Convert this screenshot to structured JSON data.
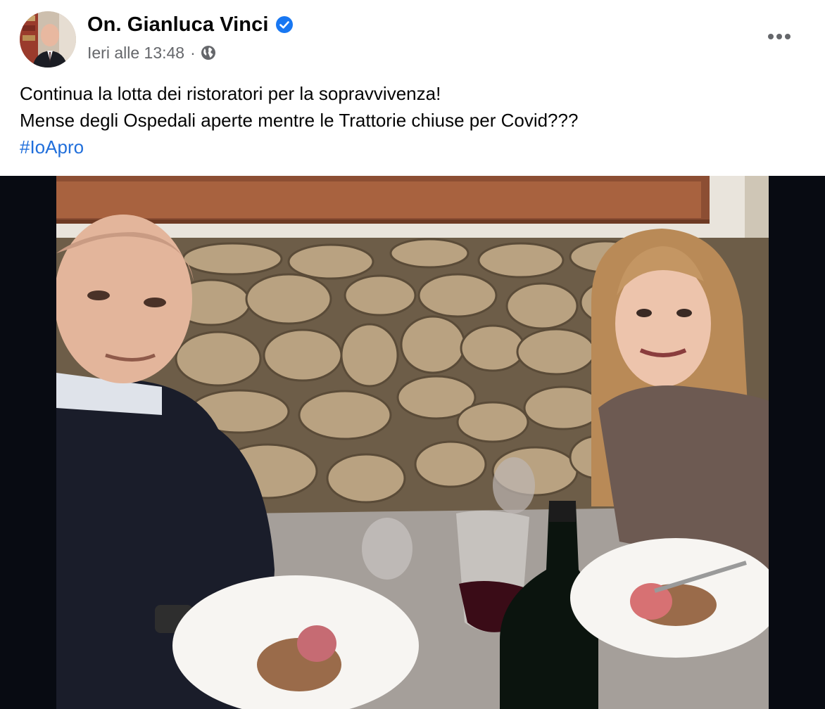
{
  "post": {
    "author": "On. Gianluca Vinci",
    "timestamp": "Ieri alle 13:48",
    "separator": "·",
    "audience_icon": "globe-icon",
    "verified_icon": "verified-badge-icon",
    "more_icon": "more-options-icon",
    "text_lines": [
      "Continua la lotta dei ristoratori per la sopravvivenza!",
      "Mense degli Ospedali aperte mentre le Trattorie chiuse per Covid???"
    ],
    "hashtag": "#IoApro"
  },
  "colors": {
    "name": "#050505",
    "meta": "#65676b",
    "verified": "#1877f2",
    "hashtag": "#216fdb",
    "photo_backdrop": "#080b12"
  }
}
